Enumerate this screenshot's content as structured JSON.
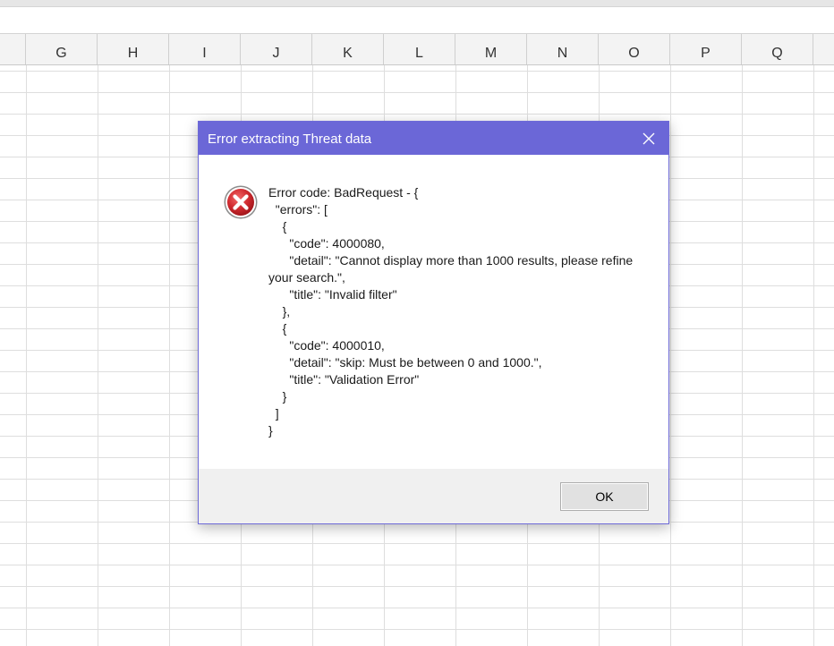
{
  "spreadsheet": {
    "columns": [
      "G",
      "H",
      "I",
      "J",
      "K",
      "L",
      "M",
      "N",
      "O",
      "P",
      "Q"
    ]
  },
  "dialog": {
    "title": "Error extracting Threat data",
    "close_icon": "close-icon",
    "error_icon": "error-circle-x-icon",
    "message": "Error code: BadRequest - {\n  \"errors\": [\n    {\n      \"code\": 4000080,\n      \"detail\": \"Cannot display more than 1000 results, please refine your search.\",\n      \"title\": \"Invalid filter\"\n    },\n    {\n      \"code\": 4000010,\n      \"detail\": \"skip: Must be between 0 and 1000.\",\n      \"title\": \"Validation Error\"\n    }\n  ]\n}",
    "ok_label": "OK"
  },
  "colors": {
    "title_bar": "#6b67d7",
    "error_red": "#c8232a"
  }
}
